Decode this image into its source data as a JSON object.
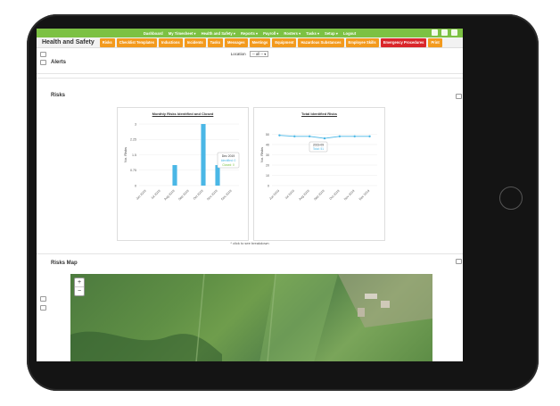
{
  "nav": {
    "items": [
      "Dashboard",
      "My Timesheet ▾",
      "Health and Safety ▾",
      "Reports ▾",
      "Payroll ▾",
      "Rosters ▾",
      "Tasks ▾",
      "Setup ▾",
      "Logout"
    ]
  },
  "module": {
    "title": "Health and Safety"
  },
  "tabs": [
    {
      "label": "Risks",
      "color": "#f39a1d"
    },
    {
      "label": "Checklist Templates",
      "color": "#f39a1d"
    },
    {
      "label": "Inductions",
      "color": "#f39a1d"
    },
    {
      "label": "Incidents",
      "color": "#f39a1d"
    },
    {
      "label": "Tasks",
      "color": "#f39a1d"
    },
    {
      "label": "Messages",
      "color": "#f39a1d"
    },
    {
      "label": "Meetings",
      "color": "#f39a1d"
    },
    {
      "label": "Equipment",
      "color": "#f39a1d"
    },
    {
      "label": "Hazardous Substances",
      "color": "#f39a1d"
    },
    {
      "label": "Employee Skills",
      "color": "#f39a1d"
    },
    {
      "label": "Emergency Procedures",
      "color": "#d9262b"
    },
    {
      "label": "Print",
      "color": "#f39a1d"
    }
  ],
  "location": {
    "label": "Location",
    "value": "-- all --"
  },
  "sections": {
    "alerts": "Alerts",
    "risks": "Risks",
    "map": "Risks Map"
  },
  "chart_note": "* click to see breakdown",
  "chart_data": [
    {
      "type": "bar",
      "title": "Monthly Risks Identified and Closed",
      "ylabel": "No. Risks",
      "categories": [
        "Jun 2019",
        "Jul 2019",
        "Aug 2019",
        "Sep 2019",
        "Oct 2019",
        "Nov 2019",
        "Dec 2019"
      ],
      "series": [
        {
          "name": "Identified",
          "values": [
            0,
            0,
            1,
            0,
            3,
            1,
            0
          ]
        }
      ],
      "ylim": [
        0,
        3
      ],
      "yticks": [
        "0",
        "0.75",
        "1.5",
        "2.25",
        "3"
      ],
      "tooltip": {
        "title": "Dec 2019",
        "identified": "Identified: 0",
        "closed": "Closed: 0"
      }
    },
    {
      "type": "line",
      "title": "Total Identified Risks",
      "ylabel": "No. Risks",
      "categories": [
        "Jun 2019",
        "Jul 2019",
        "Aug 2019",
        "Sep 2019",
        "Oct 2019",
        "Nov 2019",
        "Dec 2019"
      ],
      "series": [
        {
          "name": "Total",
          "values": [
            49,
            48,
            48,
            46,
            48,
            48,
            48
          ]
        }
      ],
      "ylim": [
        0,
        60
      ],
      "yticks": [
        "0",
        "10",
        "20",
        "30",
        "40",
        "50"
      ],
      "tooltip": {
        "title": "2019-09",
        "value": "Total: 51"
      }
    }
  ],
  "map": {
    "zoom_in": "+",
    "zoom_out": "−"
  },
  "colors": {
    "green": "#7cc143",
    "orange": "#f39a1d",
    "red": "#d9262b",
    "bar": "#4ab7e6"
  }
}
